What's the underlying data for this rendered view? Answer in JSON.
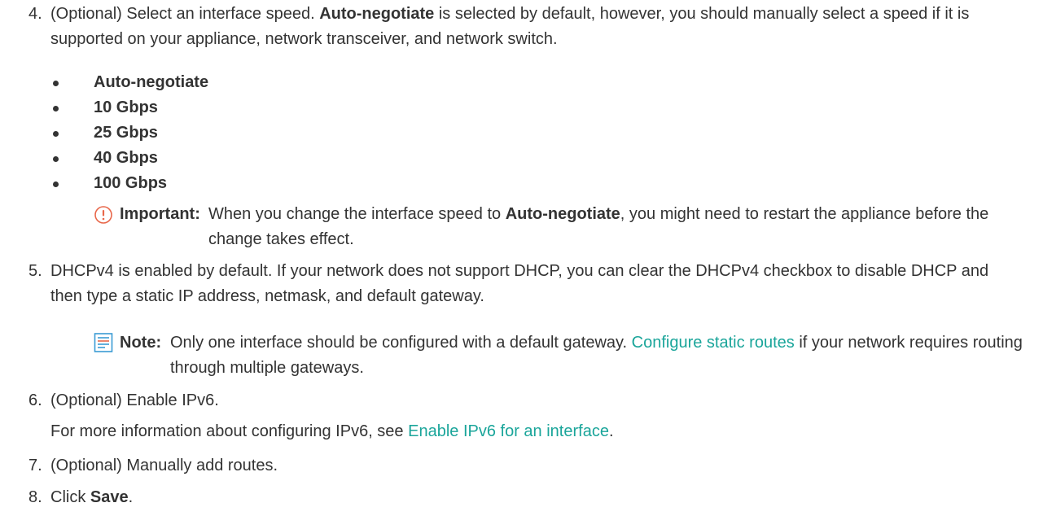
{
  "steps": [
    {
      "number": "4.",
      "text_1": "(Optional) Select an interface speed. ",
      "bold_1": "Auto-negotiate",
      "text_2": " is selected by default, however, you should manually select a speed if it is supported on your appliance, network transceiver, and network switch."
    },
    {
      "number": "5.",
      "text": "DHCPv4 is enabled by default. If your network does not support DHCP, you can clear the DHCPv4 checkbox to disable DHCP and then type a static IP address, netmask, and default gateway."
    },
    {
      "number": "6.",
      "text": "(Optional) Enable IPv6.",
      "sub_text": "For more information about configuring IPv6, see ",
      "sub_link": "Enable IPv6 for an interface",
      "sub_end": "."
    },
    {
      "number": "7.",
      "text": "(Optional) Manually add routes."
    },
    {
      "number": "8.",
      "text_1": "Click ",
      "bold_1": "Save",
      "text_2": "."
    }
  ],
  "speed_options": [
    "Auto-negotiate",
    "10 Gbps",
    "25 Gbps",
    "40 Gbps",
    "100 Gbps"
  ],
  "important": {
    "icon": "exclamation-circle-icon",
    "label": "Important:",
    "text_1": "When you change the interface speed to ",
    "bold_1": "Auto-negotiate",
    "text_2": ", you might need to restart the appliance before the change takes effect."
  },
  "note": {
    "icon": "note-icon",
    "label": "Note:",
    "text_1": "Only one interface should be configured with a default gateway. ",
    "link": "Configure static routes",
    "text_2": " if your network requires routing through multiple gateways."
  },
  "colors": {
    "text": "#333333",
    "link": "#1aa59a",
    "important_icon": "#e8674a",
    "note_icon": "#3a9bd4"
  }
}
